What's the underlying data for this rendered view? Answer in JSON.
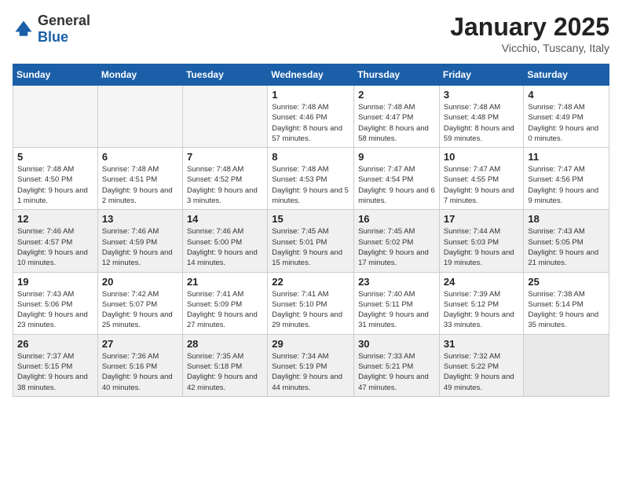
{
  "logo": {
    "general": "General",
    "blue": "Blue"
  },
  "header": {
    "month": "January 2025",
    "location": "Vicchio, Tuscany, Italy"
  },
  "weekdays": [
    "Sunday",
    "Monday",
    "Tuesday",
    "Wednesday",
    "Thursday",
    "Friday",
    "Saturday"
  ],
  "weeks": [
    {
      "shaded": false,
      "days": [
        {
          "num": "",
          "info": "",
          "empty": true
        },
        {
          "num": "",
          "info": "",
          "empty": true
        },
        {
          "num": "",
          "info": "",
          "empty": true
        },
        {
          "num": "1",
          "info": "Sunrise: 7:48 AM\nSunset: 4:46 PM\nDaylight: 8 hours and 57 minutes."
        },
        {
          "num": "2",
          "info": "Sunrise: 7:48 AM\nSunset: 4:47 PM\nDaylight: 8 hours and 58 minutes."
        },
        {
          "num": "3",
          "info": "Sunrise: 7:48 AM\nSunset: 4:48 PM\nDaylight: 8 hours and 59 minutes."
        },
        {
          "num": "4",
          "info": "Sunrise: 7:48 AM\nSunset: 4:49 PM\nDaylight: 9 hours and 0 minutes."
        }
      ]
    },
    {
      "shaded": false,
      "days": [
        {
          "num": "5",
          "info": "Sunrise: 7:48 AM\nSunset: 4:50 PM\nDaylight: 9 hours and 1 minute."
        },
        {
          "num": "6",
          "info": "Sunrise: 7:48 AM\nSunset: 4:51 PM\nDaylight: 9 hours and 2 minutes."
        },
        {
          "num": "7",
          "info": "Sunrise: 7:48 AM\nSunset: 4:52 PM\nDaylight: 9 hours and 3 minutes."
        },
        {
          "num": "8",
          "info": "Sunrise: 7:48 AM\nSunset: 4:53 PM\nDaylight: 9 hours and 5 minutes."
        },
        {
          "num": "9",
          "info": "Sunrise: 7:47 AM\nSunset: 4:54 PM\nDaylight: 9 hours and 6 minutes."
        },
        {
          "num": "10",
          "info": "Sunrise: 7:47 AM\nSunset: 4:55 PM\nDaylight: 9 hours and 7 minutes."
        },
        {
          "num": "11",
          "info": "Sunrise: 7:47 AM\nSunset: 4:56 PM\nDaylight: 9 hours and 9 minutes."
        }
      ]
    },
    {
      "shaded": true,
      "days": [
        {
          "num": "12",
          "info": "Sunrise: 7:46 AM\nSunset: 4:57 PM\nDaylight: 9 hours and 10 minutes."
        },
        {
          "num": "13",
          "info": "Sunrise: 7:46 AM\nSunset: 4:59 PM\nDaylight: 9 hours and 12 minutes."
        },
        {
          "num": "14",
          "info": "Sunrise: 7:46 AM\nSunset: 5:00 PM\nDaylight: 9 hours and 14 minutes."
        },
        {
          "num": "15",
          "info": "Sunrise: 7:45 AM\nSunset: 5:01 PM\nDaylight: 9 hours and 15 minutes."
        },
        {
          "num": "16",
          "info": "Sunrise: 7:45 AM\nSunset: 5:02 PM\nDaylight: 9 hours and 17 minutes."
        },
        {
          "num": "17",
          "info": "Sunrise: 7:44 AM\nSunset: 5:03 PM\nDaylight: 9 hours and 19 minutes."
        },
        {
          "num": "18",
          "info": "Sunrise: 7:43 AM\nSunset: 5:05 PM\nDaylight: 9 hours and 21 minutes."
        }
      ]
    },
    {
      "shaded": false,
      "days": [
        {
          "num": "19",
          "info": "Sunrise: 7:43 AM\nSunset: 5:06 PM\nDaylight: 9 hours and 23 minutes."
        },
        {
          "num": "20",
          "info": "Sunrise: 7:42 AM\nSunset: 5:07 PM\nDaylight: 9 hours and 25 minutes."
        },
        {
          "num": "21",
          "info": "Sunrise: 7:41 AM\nSunset: 5:09 PM\nDaylight: 9 hours and 27 minutes."
        },
        {
          "num": "22",
          "info": "Sunrise: 7:41 AM\nSunset: 5:10 PM\nDaylight: 9 hours and 29 minutes."
        },
        {
          "num": "23",
          "info": "Sunrise: 7:40 AM\nSunset: 5:11 PM\nDaylight: 9 hours and 31 minutes."
        },
        {
          "num": "24",
          "info": "Sunrise: 7:39 AM\nSunset: 5:12 PM\nDaylight: 9 hours and 33 minutes."
        },
        {
          "num": "25",
          "info": "Sunrise: 7:38 AM\nSunset: 5:14 PM\nDaylight: 9 hours and 35 minutes."
        }
      ]
    },
    {
      "shaded": true,
      "days": [
        {
          "num": "26",
          "info": "Sunrise: 7:37 AM\nSunset: 5:15 PM\nDaylight: 9 hours and 38 minutes."
        },
        {
          "num": "27",
          "info": "Sunrise: 7:36 AM\nSunset: 5:16 PM\nDaylight: 9 hours and 40 minutes."
        },
        {
          "num": "28",
          "info": "Sunrise: 7:35 AM\nSunset: 5:18 PM\nDaylight: 9 hours and 42 minutes."
        },
        {
          "num": "29",
          "info": "Sunrise: 7:34 AM\nSunset: 5:19 PM\nDaylight: 9 hours and 44 minutes."
        },
        {
          "num": "30",
          "info": "Sunrise: 7:33 AM\nSunset: 5:21 PM\nDaylight: 9 hours and 47 minutes."
        },
        {
          "num": "31",
          "info": "Sunrise: 7:32 AM\nSunset: 5:22 PM\nDaylight: 9 hours and 49 minutes."
        },
        {
          "num": "",
          "info": "",
          "empty": true
        }
      ]
    }
  ]
}
